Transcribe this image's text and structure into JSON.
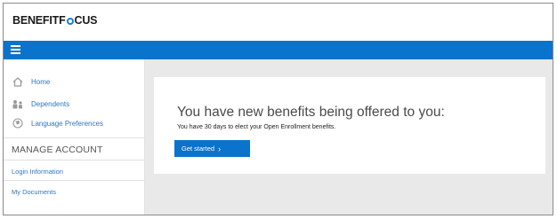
{
  "brand": {
    "name_part1": "BENEFITF",
    "name_part2": "CUS"
  },
  "nav": {
    "home": "Home",
    "dependents": "Dependents",
    "language": "Language Preferences"
  },
  "manage_account": {
    "heading": "MANAGE ACCOUNT",
    "login": "Login Information",
    "documents": "My Documents"
  },
  "banner": {
    "headline": "You have new benefits being offered to you:",
    "subline": "You have 30 days to elect your Open Enrollment benefits.",
    "cta": "Get started"
  },
  "colors": {
    "accent": "#0a73cc",
    "link": "#2a77c7",
    "content_bg": "#e9e9e9"
  },
  "icons": [
    "menu-icon",
    "home-icon",
    "dependents-icon",
    "globe-icon",
    "chevron-right-icon"
  ]
}
